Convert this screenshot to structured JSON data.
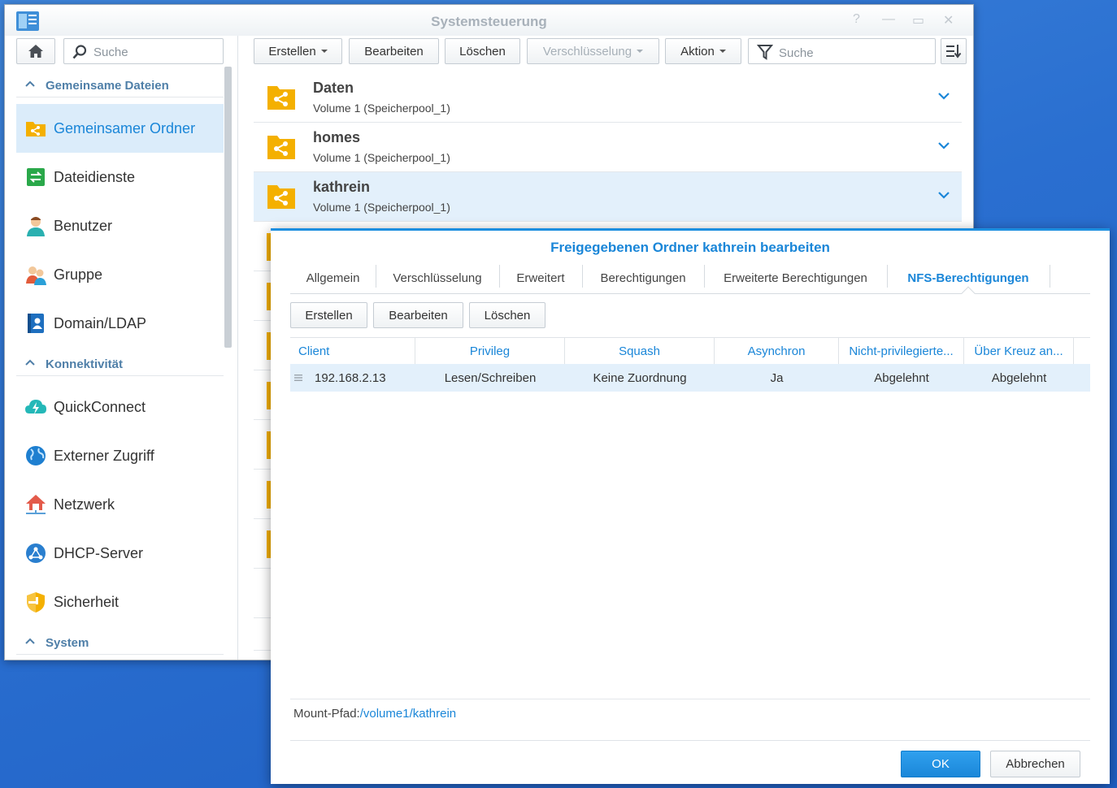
{
  "window": {
    "title": "Systemsteuerung",
    "controls": {
      "help": "?",
      "minimize": "—",
      "maximize": "▭",
      "close": "✕"
    }
  },
  "sidebar": {
    "search_placeholder": "Suche",
    "groups": [
      {
        "label": "Gemeinsame Dateien",
        "items": [
          {
            "label": "Gemeinsamer Ordner",
            "icon": "shared-folder-icon",
            "active": true
          },
          {
            "label": "Dateidienste",
            "icon": "file-services-icon"
          },
          {
            "label": "Benutzer",
            "icon": "user-icon"
          },
          {
            "label": "Gruppe",
            "icon": "group-icon"
          },
          {
            "label": "Domain/LDAP",
            "icon": "domain-ldap-icon"
          }
        ]
      },
      {
        "label": "Konnektivität",
        "items": [
          {
            "label": "QuickConnect",
            "icon": "quickconnect-icon"
          },
          {
            "label": "Externer Zugriff",
            "icon": "external-access-icon"
          },
          {
            "label": "Netzwerk",
            "icon": "network-icon"
          },
          {
            "label": "DHCP-Server",
            "icon": "dhcp-server-icon"
          },
          {
            "label": "Sicherheit",
            "icon": "security-shield-icon"
          }
        ]
      },
      {
        "label": "System",
        "items": []
      }
    ]
  },
  "toolbar": {
    "create": "Erstellen",
    "edit": "Bearbeiten",
    "delete": "Löschen",
    "encryption": "Verschlüsselung",
    "action": "Aktion",
    "search_placeholder": "Suche"
  },
  "folders": [
    {
      "name": "Daten",
      "volume": "Volume 1 (Speicherpool_1)"
    },
    {
      "name": "homes",
      "volume": "Volume 1 (Speicherpool_1)"
    },
    {
      "name": "kathrein",
      "volume": "Volume 1 (Speicherpool_1)",
      "selected": true
    }
  ],
  "dialog": {
    "title": "Freigegebenen Ordner kathrein bearbeiten",
    "tabs": [
      "Allgemein",
      "Verschlüsselung",
      "Erweitert",
      "Berechtigungen",
      "Erweiterte Berechtigungen",
      "NFS-Berechtigungen"
    ],
    "active_tab": "NFS-Berechtigungen",
    "buttons": {
      "create": "Erstellen",
      "edit": "Bearbeiten",
      "delete": "Löschen"
    },
    "columns": [
      "Client",
      "Privileg",
      "Squash",
      "Asynchron",
      "Nicht-privilegierte...",
      "Über Kreuz an..."
    ],
    "rows": [
      {
        "client": "192.168.2.13",
        "privilege": "Lesen/Schreiben",
        "squash": "Keine Zuordnung",
        "async": "Ja",
        "non_privileged": "Abgelehnt",
        "cross_mount": "Abgelehnt"
      }
    ],
    "mount_label": "Mount-Pfad:",
    "mount_path": "/volume1/kathrein",
    "ok": "OK",
    "cancel": "Abbrechen"
  },
  "colors": {
    "accent": "#1a86d8",
    "folder": "#f4b000",
    "selection": "#e3f0fb"
  }
}
